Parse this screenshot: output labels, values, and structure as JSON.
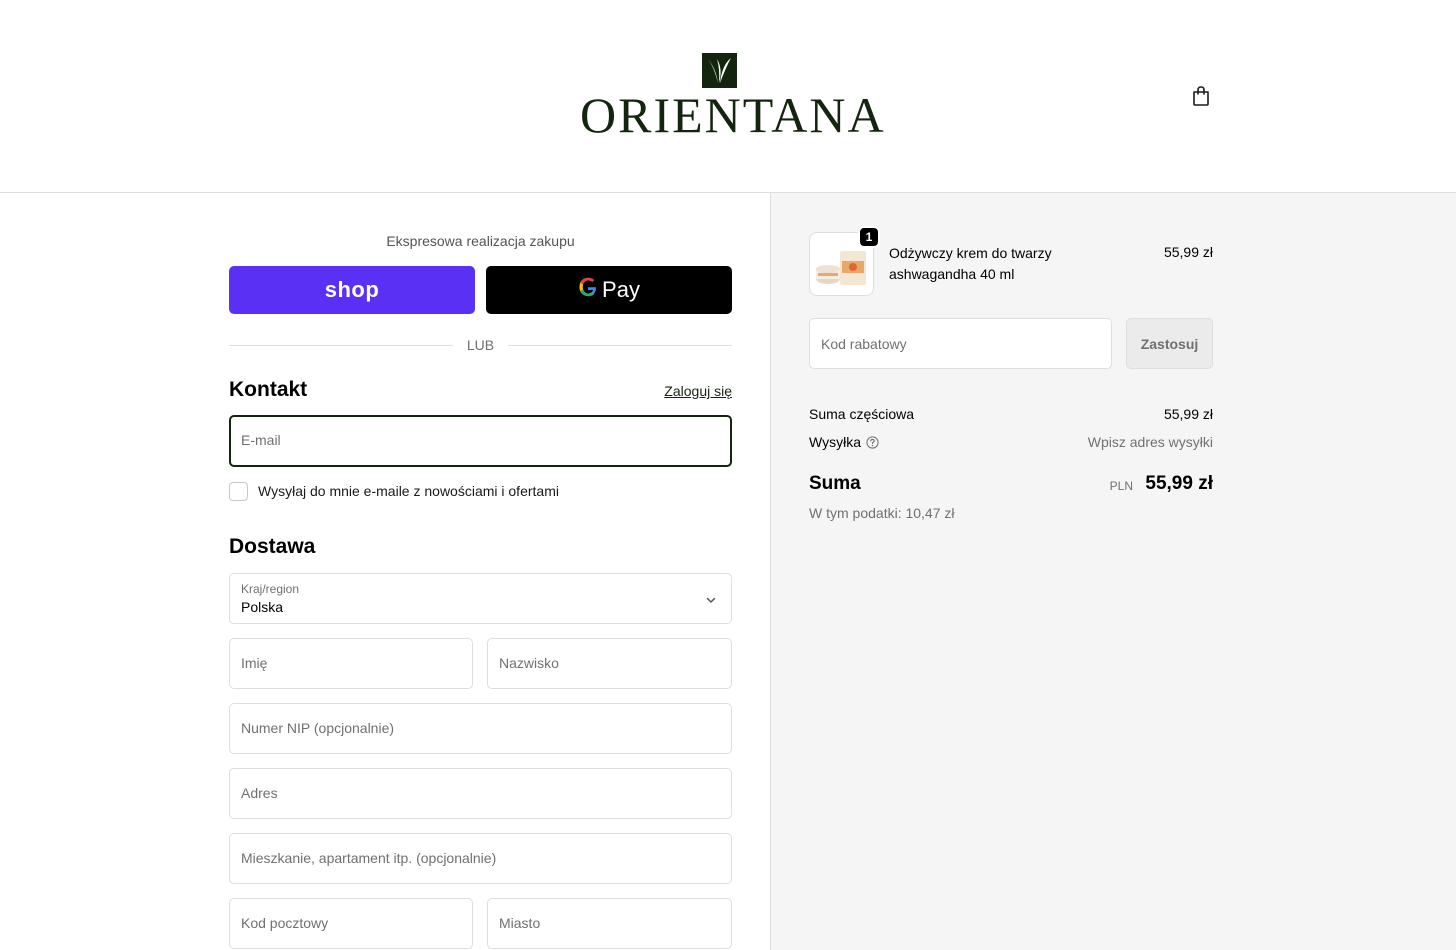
{
  "header": {
    "logo_text": "ORIENTANA",
    "cart_icon": "shopping-bag-icon"
  },
  "express": {
    "title": "Ekspresowa realizacja zakupu",
    "shop_label": "shop",
    "gpay_label": "Pay",
    "divider": "LUB"
  },
  "contact": {
    "title": "Kontakt",
    "login_link": "Zaloguj się",
    "email_placeholder": "E-mail",
    "newsletter_label": "Wysyłaj do mnie e-maile z nowościami i ofertami",
    "newsletter_checked": false
  },
  "delivery": {
    "title": "Dostawa",
    "country_label": "Kraj/region",
    "country_value": "Polska",
    "first_name_placeholder": "Imię",
    "last_name_placeholder": "Nazwisko",
    "nip_placeholder": "Numer NIP (opcjonalnie)",
    "address_placeholder": "Adres",
    "apartment_placeholder": "Mieszkanie, apartament itp. (opcjonalnie)",
    "postal_placeholder": "Kod pocztowy",
    "city_placeholder": "Miasto"
  },
  "summary": {
    "item": {
      "quantity": "1",
      "name": "Odżywczy krem do twarzy ashwagandha 40 ml",
      "price": "55,99 zł"
    },
    "discount_placeholder": "Kod rabatowy",
    "apply_label": "Zastosuj",
    "subtotal_label": "Suma częściowa",
    "subtotal_value": "55,99 zł",
    "shipping_label": "Wysyłka",
    "shipping_value": "Wpisz adres wysyłki",
    "total_label": "Suma",
    "currency": "PLN",
    "total_value": "55,99 zł",
    "taxes": "W tym podatki: 10,47 zł"
  },
  "colors": {
    "brand_green": "#14250f",
    "shop_pay": "#5a31f4",
    "summary_bg": "#f5f5f5"
  }
}
